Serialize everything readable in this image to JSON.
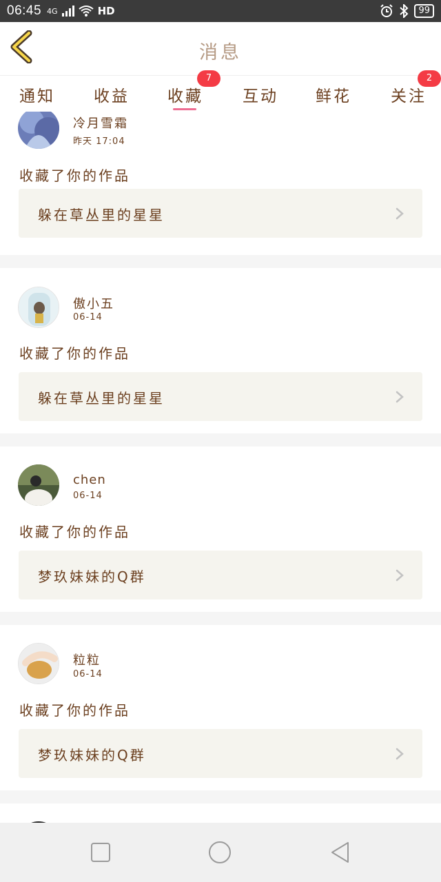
{
  "status": {
    "time": "06:45",
    "network": "4G",
    "hd": "HD",
    "battery": "99"
  },
  "header": {
    "title": "消息"
  },
  "tabs": [
    {
      "label": "通知"
    },
    {
      "label": "收益"
    },
    {
      "label": "收藏",
      "badge": "7",
      "active": true
    },
    {
      "label": "互动"
    },
    {
      "label": "鲜花"
    },
    {
      "label": "关注",
      "badge": "2"
    }
  ],
  "feed": [
    {
      "user": "冷月雪霜",
      "time": "昨天 17:04",
      "action": "收藏了你的作品",
      "work": "躲在草丛里的星星"
    },
    {
      "user": "傲小五",
      "time": "06-14",
      "action": "收藏了你的作品",
      "work": "躲在草丛里的星星"
    },
    {
      "user": "chen",
      "time": "06-14",
      "action": "收藏了你的作品",
      "work": "梦玖妹妹的Q群"
    },
    {
      "user": "粒粒",
      "time": "06-14",
      "action": "收藏了你的作品",
      "work": "梦玖妹妹的Q群"
    }
  ],
  "colors": {
    "accent": "#ee6d92",
    "badge": "#f43b45",
    "text": "#6b3f1f",
    "title": "#b59a84",
    "work_bg": "#f5f4ee"
  },
  "icons": {
    "back": "chevron-left-icon",
    "chevron": "chevron-right-icon",
    "nav": [
      "square-icon",
      "circle-icon",
      "triangle-back-icon"
    ]
  }
}
